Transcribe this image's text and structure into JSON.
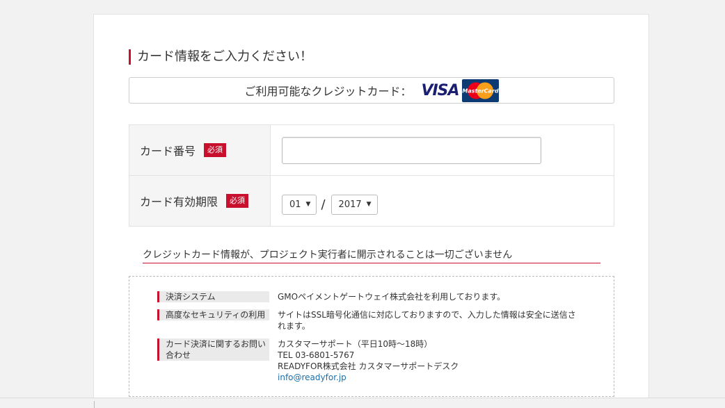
{
  "section": {
    "title": "カード情報をご入力ください！"
  },
  "accepted_cards": {
    "label": "ご利用可能なクレジットカード：",
    "visa_text": "VISA",
    "mastercard_text": "MasterCard"
  },
  "form": {
    "card_number": {
      "label": "カード番号",
      "required_badge": "必須",
      "value": ""
    },
    "expiry": {
      "label": "カード有効期限",
      "required_badge": "必須",
      "month": "01",
      "separator": "/",
      "year": "2017"
    }
  },
  "notice": "クレジットカード情報が、プロジェクト実行者に開示されることは一切ございません",
  "info": {
    "rows": [
      {
        "key": "決済システム",
        "lines": [
          "GMOペイメントゲートウェイ株式会社を利用しております。"
        ]
      },
      {
        "key": "高度なセキュリティの利用",
        "lines": [
          "サイトはSSL暗号化通信に対応しておりますので、入力した情報は安全に送信さ",
          "れます。"
        ]
      },
      {
        "key_lines": [
          "カード決済に関するお問い",
          "合わせ"
        ],
        "lines": [
          "カスタマーサポート（平日10時〜18時）",
          "TEL 03-6801-5767",
          "READYFOR株式会社 カスタマーサポートデスク"
        ],
        "email": "info@readyfor.jp"
      }
    ]
  },
  "colors": {
    "accent": "#c8102e",
    "link": "#1a6faa",
    "visa_blue": "#1a1f71",
    "mastercard_bg": "#0c3b73"
  }
}
